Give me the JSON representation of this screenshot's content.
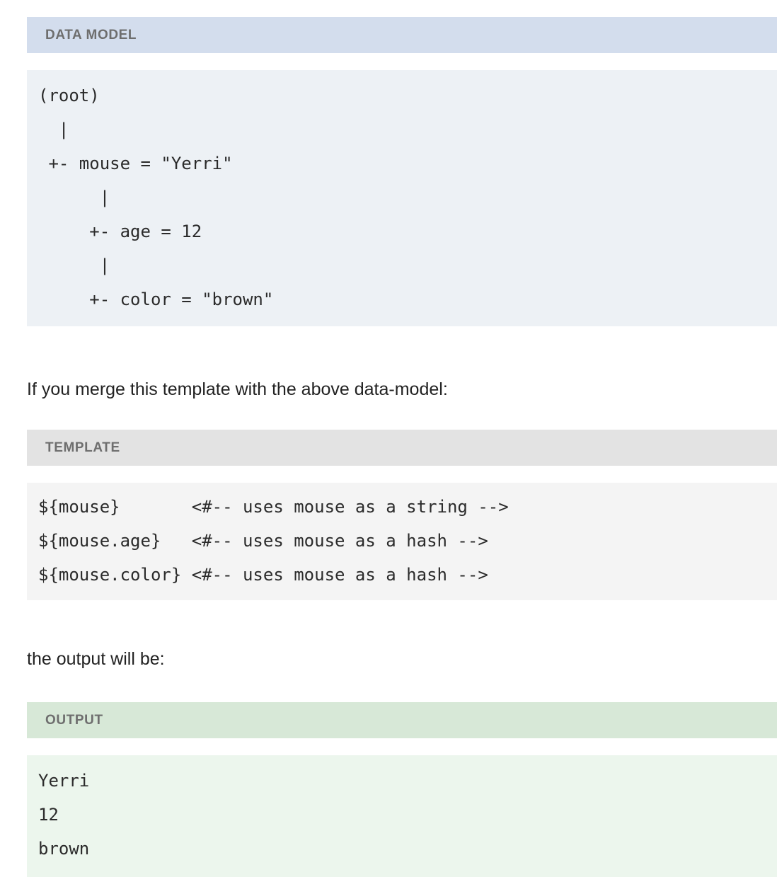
{
  "page": {
    "background": "#ffffff",
    "text_color": "#222222"
  },
  "panels": {
    "data_model": {
      "title": "DATA MODEL",
      "header_color": "#d3dded",
      "body_color": "#edf1f5",
      "lines": [
        "(root)",
        "  |",
        " +- mouse = \"Yerri\"",
        "      |",
        "     +- age = 12",
        "      |",
        "     +- color = \"brown\""
      ]
    },
    "template": {
      "title": "TEMPLATE",
      "header_color": "#e3e3e3",
      "body_color": "#f4f4f4",
      "lines": [
        "${mouse}       <#-- uses mouse as a string -->",
        "${mouse.age}   <#-- uses mouse as a hash -->",
        "${mouse.color} <#-- uses mouse as a hash -->"
      ]
    },
    "output": {
      "title": "OUTPUT",
      "header_color": "#d7e8d7",
      "body_color": "#ecf6ed",
      "lines": [
        "Yerri",
        "12",
        "brown"
      ]
    }
  },
  "prose": {
    "merge_sentence": "If you merge this template with the above data-model:",
    "output_sentence": "the output will be:"
  }
}
